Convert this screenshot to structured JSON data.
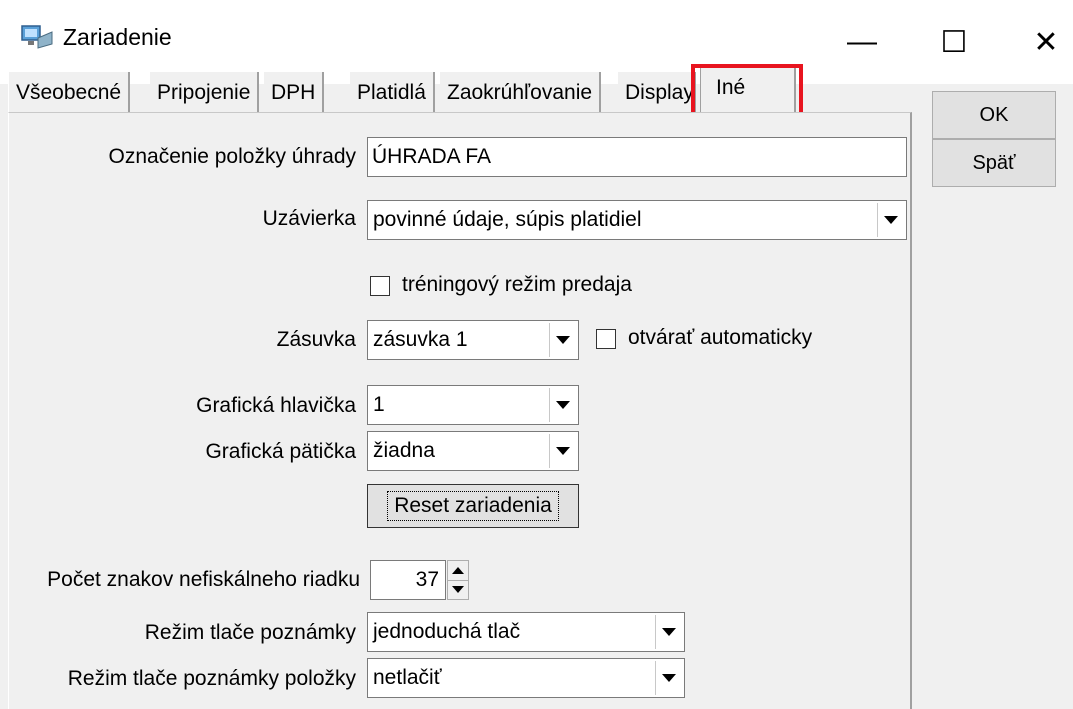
{
  "window": {
    "title": "Zariadenie",
    "icon": "device-computer-icon",
    "minimize_glyph": "—",
    "maximize_glyph": "☐",
    "close_glyph": "✕"
  },
  "tabs": [
    {
      "label": "Všeobecné",
      "active": false
    },
    {
      "label": "Pripojenie",
      "active": false
    },
    {
      "label": "DPH",
      "active": false
    },
    {
      "label": "Platidlá",
      "active": false
    },
    {
      "label": "Zaokrúhľovanie",
      "active": false
    },
    {
      "label": "Display",
      "active": false
    },
    {
      "label": "Iné",
      "active": true
    }
  ],
  "highlight_color": "#e8141f",
  "buttons": {
    "ok": "OK",
    "back": "Späť",
    "reset": "Reset zariadenia"
  },
  "form": {
    "oznacenie": {
      "label": "Označenie položky úhrady",
      "value": "ÚHRADA FA"
    },
    "uzavierka": {
      "label": "Uzávierka",
      "value": "povinné údaje, súpis platidiel"
    },
    "trening": {
      "label": "tréningový režim predaja",
      "checked": false
    },
    "zasuvka": {
      "label": "Zásuvka",
      "value": "zásuvka 1"
    },
    "otvarat": {
      "label": "otvárať automaticky",
      "checked": false
    },
    "hlavicka": {
      "label": "Grafická hlavička",
      "value": "1"
    },
    "paticka": {
      "label": "Grafická pätička",
      "value": "žiadna"
    },
    "pocet": {
      "label": "Počet znakov nefiskálneho riadku",
      "value": "37"
    },
    "rezim_poznamky": {
      "label": "Režim tlače poznámky",
      "value": "jednoduchá tlač"
    },
    "rezim_poznamky_polozky": {
      "label": "Režim tlače poznámky položky",
      "value": "netlačiť"
    }
  }
}
